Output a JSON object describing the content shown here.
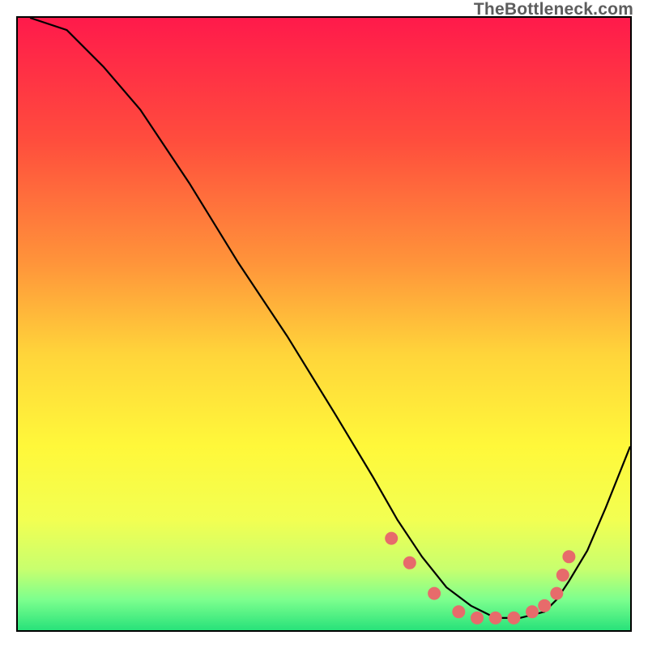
{
  "watermark": "TheBottleneck.com",
  "chart_data": {
    "type": "line",
    "title": "",
    "xlabel": "",
    "ylabel": "",
    "xlim": [
      0,
      100
    ],
    "ylim": [
      0,
      100
    ],
    "grid": false,
    "legend": false,
    "background": {
      "type": "vertical-gradient",
      "stops": [
        {
          "pos": 0.0,
          "color": "#ff1a4b"
        },
        {
          "pos": 0.2,
          "color": "#ff4d3d"
        },
        {
          "pos": 0.4,
          "color": "#ff943a"
        },
        {
          "pos": 0.55,
          "color": "#ffd53a"
        },
        {
          "pos": 0.7,
          "color": "#fff83a"
        },
        {
          "pos": 0.82,
          "color": "#f2ff52"
        },
        {
          "pos": 0.9,
          "color": "#c8ff6e"
        },
        {
          "pos": 0.95,
          "color": "#7dff8e"
        },
        {
          "pos": 1.0,
          "color": "#28e27a"
        }
      ]
    },
    "series": [
      {
        "name": "curve",
        "stroke": "#000000",
        "stroke_width": 2.2,
        "x": [
          2,
          8,
          14,
          20,
          28,
          36,
          44,
          52,
          58,
          62,
          66,
          70,
          74,
          78,
          82,
          86,
          88,
          90,
          93,
          96,
          100
        ],
        "y": [
          100,
          98,
          92,
          85,
          73,
          60,
          48,
          35,
          25,
          18,
          12,
          7,
          4,
          2,
          2,
          3,
          5,
          8,
          13,
          20,
          30
        ]
      }
    ],
    "markers": {
      "name": "dots",
      "fill": "#e76b6b",
      "radius": 8,
      "x": [
        61,
        64,
        68,
        72,
        75,
        78,
        81,
        84,
        86,
        88,
        89,
        90
      ],
      "y": [
        15,
        11,
        6,
        3,
        2,
        2,
        2,
        3,
        4,
        6,
        9,
        12
      ]
    }
  }
}
